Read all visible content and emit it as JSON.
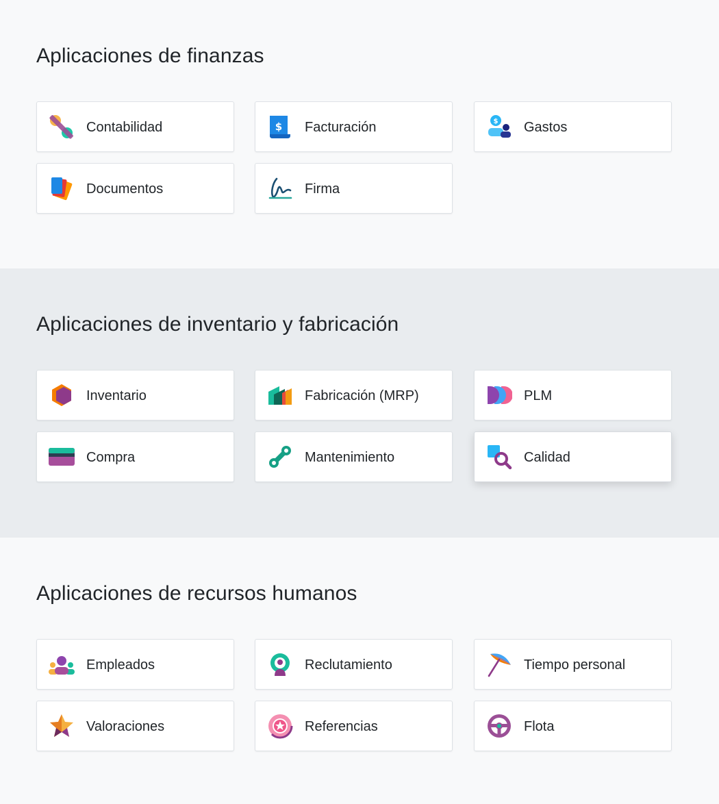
{
  "sections": [
    {
      "title": "Aplicaciones de finanzas",
      "apps": [
        {
          "label": "Contabilidad",
          "icon": "accounting-icon"
        },
        {
          "label": "Facturación",
          "icon": "invoicing-icon"
        },
        {
          "label": "Gastos",
          "icon": "expenses-icon"
        },
        {
          "label": "Documentos",
          "icon": "documents-icon"
        },
        {
          "label": "Firma",
          "icon": "sign-icon"
        }
      ]
    },
    {
      "title": "Aplicaciones de inventario y fabricación",
      "apps": [
        {
          "label": "Inventario",
          "icon": "inventory-icon"
        },
        {
          "label": "Fabricación (MRP)",
          "icon": "manufacturing-icon"
        },
        {
          "label": "PLM",
          "icon": "plm-icon"
        },
        {
          "label": "Compra",
          "icon": "purchase-icon"
        },
        {
          "label": "Mantenimiento",
          "icon": "maintenance-icon"
        },
        {
          "label": "Calidad",
          "icon": "quality-icon"
        }
      ]
    },
    {
      "title": "Aplicaciones de recursos humanos",
      "apps": [
        {
          "label": "Empleados",
          "icon": "employees-icon"
        },
        {
          "label": "Reclutamiento",
          "icon": "recruitment-icon"
        },
        {
          "label": "Tiempo personal",
          "icon": "time-off-icon"
        },
        {
          "label": "Valoraciones",
          "icon": "appraisals-icon"
        },
        {
          "label": "Referencias",
          "icon": "referrals-icon"
        },
        {
          "label": "Flota",
          "icon": "fleet-icon"
        }
      ]
    }
  ]
}
